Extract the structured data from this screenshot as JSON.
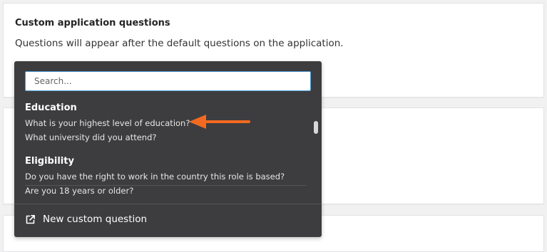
{
  "section": {
    "title": "Custom application questions",
    "description": "Questions will appear after the default questions on the application."
  },
  "search": {
    "placeholder": "Search...",
    "value": ""
  },
  "groups": [
    {
      "title": "Education",
      "questions": [
        "What is your highest level of education?",
        "What university did you attend?"
      ]
    },
    {
      "title": "Eligibility",
      "questions": [
        "Do you have the right to work in the country this role is based?",
        "Are you 18 years or older?"
      ]
    }
  ],
  "footer": {
    "new_question_label": "New custom question",
    "icon": "external-link-icon"
  },
  "annotation": {
    "icon": "arrow-left-icon",
    "color": "#f26a21"
  },
  "colors": {
    "dropdown_bg": "#3d3d3f",
    "input_focus_border": "#4a9bd6",
    "page_bg": "#f1f1f2"
  }
}
